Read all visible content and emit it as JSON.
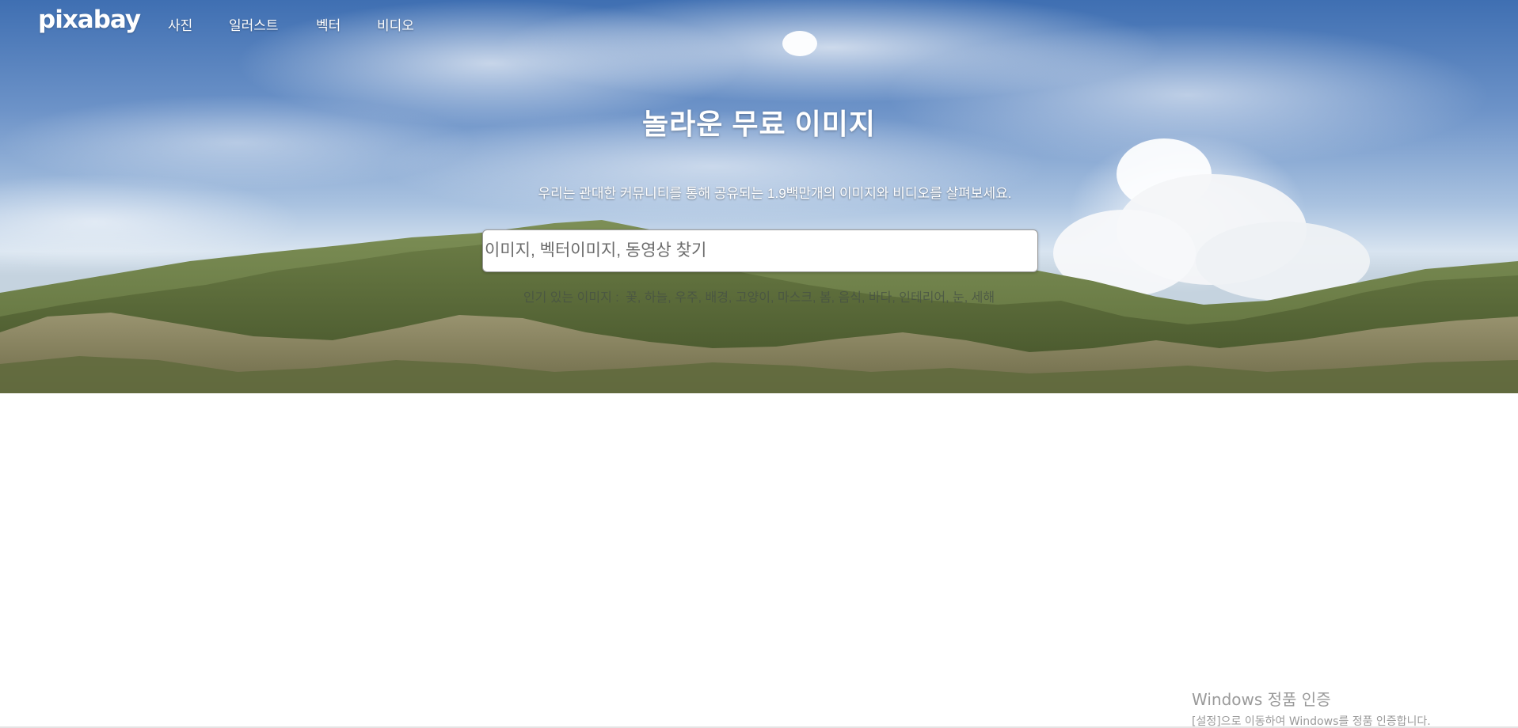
{
  "brand": {
    "logo_text": "pixabay"
  },
  "nav": {
    "items": [
      {
        "label": "사진"
      },
      {
        "label": "일러스트"
      },
      {
        "label": "벡터"
      },
      {
        "label": "비디오"
      }
    ]
  },
  "hero": {
    "title": "놀라운 무료 이미지",
    "subtitle": "우리는 관대한 커뮤니티를 통해 공유되는 1.9백만개의 이미지와 비디오를 살펴보세요.",
    "search": {
      "placeholder": "이미지, 벡터이미지, 동영상 찾기",
      "value": ""
    },
    "popular": {
      "label": "인기 있는 이미지 :",
      "tags": [
        "꽃",
        "하늘",
        "우주",
        "배경",
        "고양이",
        "마스크",
        "봄",
        "음식",
        "바다",
        "인테리어",
        "눈",
        "세해"
      ]
    }
  },
  "windows_watermark": {
    "title": "Windows 정품 인증",
    "description": "[설정]으로 이동하여 Windows를 정품 인증합니다."
  }
}
